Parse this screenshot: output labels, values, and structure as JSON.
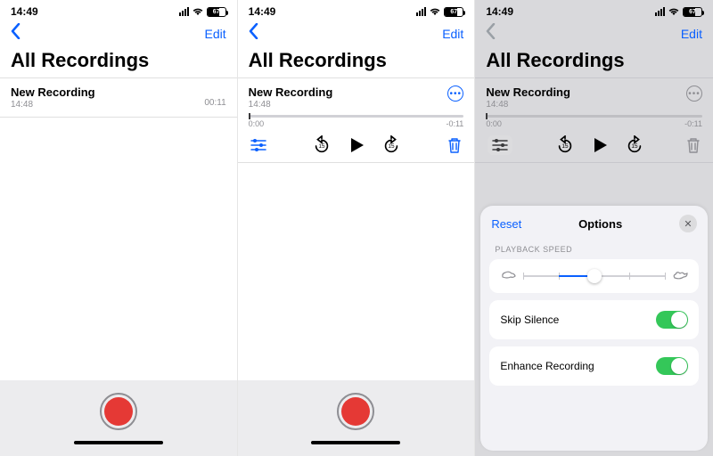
{
  "status": {
    "time": "14:49",
    "battery_pct": "67"
  },
  "nav": {
    "edit": "Edit"
  },
  "title": "All Recordings",
  "recording": {
    "name": "New Recording",
    "subtime": "14:48",
    "duration": "00:11"
  },
  "track": {
    "pos": "0:00",
    "rem": "-0:11"
  },
  "skip": {
    "back": "15",
    "fwd": "15"
  },
  "sheet": {
    "reset": "Reset",
    "title": "Options",
    "speed_label": "PLAYBACK SPEED",
    "skip_silence": "Skip Silence",
    "enhance": "Enhance Recording"
  }
}
